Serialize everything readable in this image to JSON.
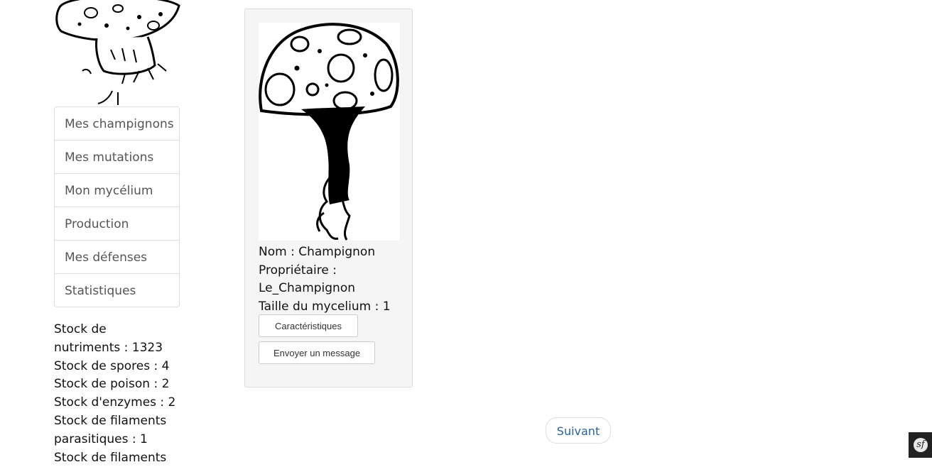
{
  "logo": {
    "icon": "mushroom-illustration-icon"
  },
  "nav": {
    "items": [
      {
        "label": "Mes champignons"
      },
      {
        "label": "Mes mutations"
      },
      {
        "label": "Mon mycélium"
      },
      {
        "label": "Production"
      },
      {
        "label": "Mes défenses"
      },
      {
        "label": "Statistiques"
      }
    ]
  },
  "stocks": [
    {
      "text": "Stock de"
    },
    {
      "text": "nutriments : 1323"
    },
    {
      "text": "Stock de spores : 4"
    },
    {
      "text": "Stock de poison : 2"
    },
    {
      "text": "Stock d'enzymes : 2"
    },
    {
      "text": "Stock de filaments"
    },
    {
      "text": "parasitiques : 1"
    },
    {
      "text": "Stock de filaments"
    }
  ],
  "card": {
    "image_icon": "mushroom-drawing-icon",
    "lines": [
      {
        "text": "Nom : Champignon"
      },
      {
        "text": "Propriétaire :"
      },
      {
        "text": "Le_Champignon"
      },
      {
        "text": "Taille du mycelium : 1"
      }
    ],
    "buttons": {
      "characteristics": "Caractéristiques",
      "send_message": "Envoyer un message"
    }
  },
  "pagination": {
    "next_label": "Suivant"
  },
  "debug_toolbar": {
    "icon": "symfony-icon",
    "glyph": "sf"
  }
}
